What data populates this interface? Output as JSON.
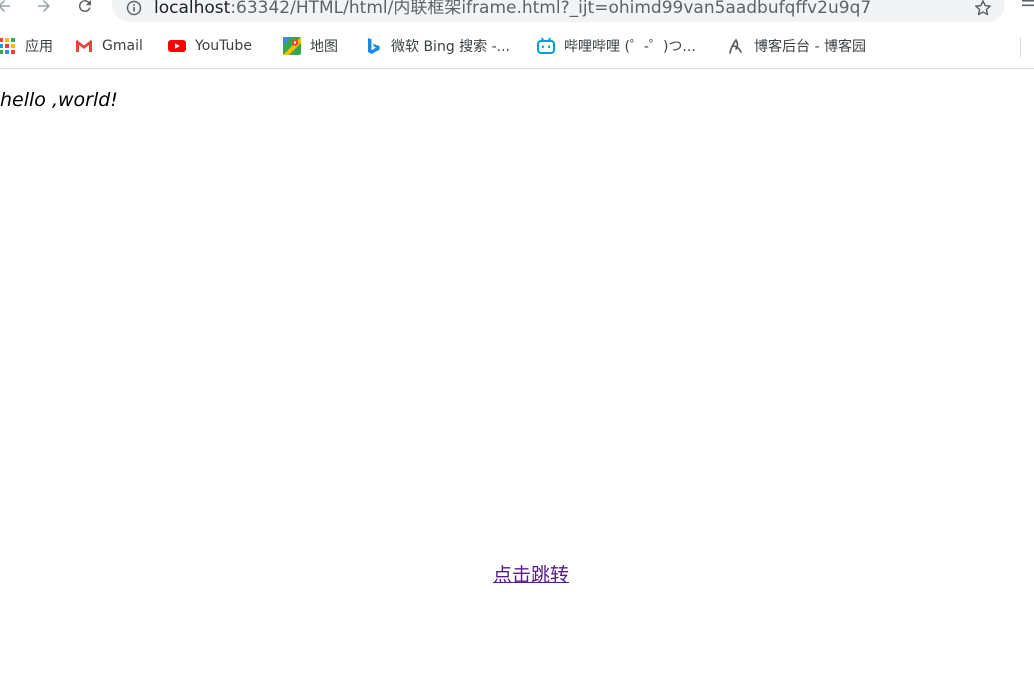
{
  "browser": {
    "url_host": "localhost",
    "url_rest": ":63342/HTML/html/内联框架iframe.html?_ijt=ohimd99van5aadbufqffv2u9q7"
  },
  "bookmarks": [
    {
      "label": "应用",
      "icon": "apps-grid-icon"
    },
    {
      "label": "Gmail",
      "icon": "gmail-icon"
    },
    {
      "label": "YouTube",
      "icon": "youtube-icon"
    },
    {
      "label": "地图",
      "icon": "maps-icon"
    },
    {
      "label": "微软 Bing 搜索 -...",
      "icon": "bing-icon"
    },
    {
      "label": "哔哩哔哩 (゜-゜)つ...",
      "icon": "bilibili-icon"
    },
    {
      "label": "博客后台 - 博客园",
      "icon": "cnblogs-icon"
    }
  ],
  "page": {
    "heading": "hello ,world!",
    "link_text": "点击跳转"
  },
  "colors": {
    "visited_link": "#551a8b",
    "omnibox_bg": "#f1f3f4"
  }
}
